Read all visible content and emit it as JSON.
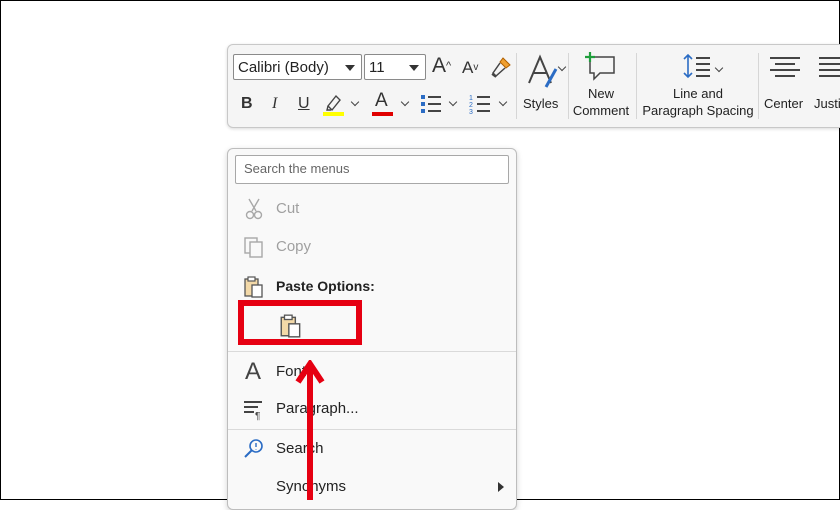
{
  "toolbar": {
    "font_name": "Calibri (Body)",
    "font_size": "11",
    "grow_font": "A",
    "shrink_font": "A",
    "bold": "B",
    "italic": "I",
    "underline": "U",
    "font_color_letter": "A",
    "styles_label": "Styles",
    "new_comment_line1": "New",
    "new_comment_line2": "Comment",
    "line_spacing_line1": "Line and",
    "line_spacing_line2": "Paragraph Spacing",
    "center_label": "Center",
    "justify_label": "Justi",
    "highlight_color": "#ffff00",
    "font_color": "#e00000"
  },
  "context_menu": {
    "search_placeholder": "Search the menus",
    "items": {
      "cut": "Cut",
      "copy": "Copy",
      "paste_options": "Paste Options:",
      "font": "Font...",
      "paragraph": "Paragraph...",
      "search": "Search",
      "synonyms": "Synonyms"
    }
  },
  "annotation": {
    "color": "#e60012"
  }
}
